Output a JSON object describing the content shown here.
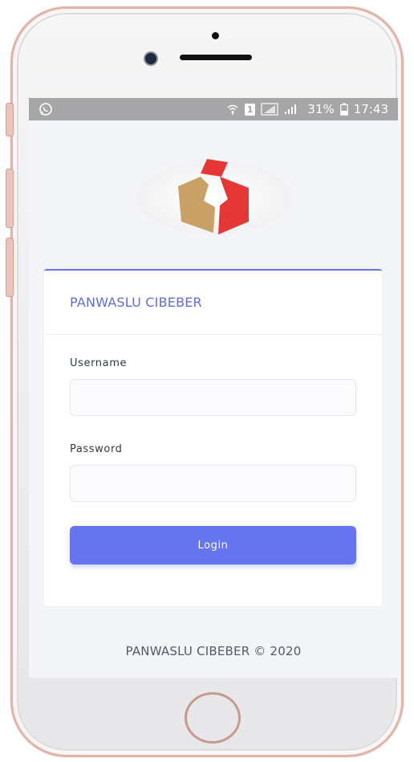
{
  "status_bar": {
    "battery": "31%",
    "time": "17:43",
    "sim_slot": "1"
  },
  "brand": {
    "logo_colors": {
      "gold": "#c9a065",
      "red": "#e63737"
    }
  },
  "login_card": {
    "title": "PANWASLU CIBEBER",
    "username_label": "Username",
    "username_value": "",
    "password_label": "Password",
    "password_value": "",
    "login_label": "Login"
  },
  "footer": {
    "text": "PANWASLU CIBEBER © 2020"
  },
  "colors": {
    "accent": "#6675ef",
    "title": "#5e6ed8",
    "statusbar": "#a6a6a8",
    "phone_frame": "#e2b3a7"
  },
  "icons": [
    "whatsapp-icon",
    "wifi-icon",
    "sim-icon",
    "signal-icon",
    "battery-icon"
  ]
}
